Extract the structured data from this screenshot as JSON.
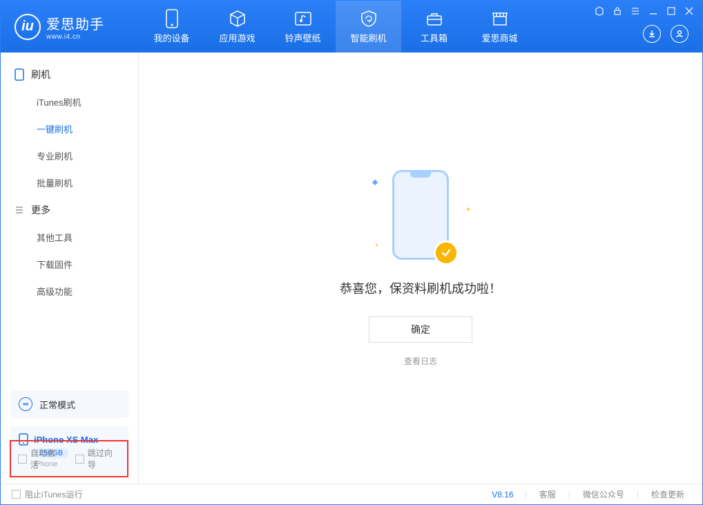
{
  "logo": {
    "main": "爱思助手",
    "sub": "www.i4.cn",
    "mark": "iu"
  },
  "nav": [
    {
      "label": "我的设备"
    },
    {
      "label": "应用游戏"
    },
    {
      "label": "铃声壁纸"
    },
    {
      "label": "智能刷机"
    },
    {
      "label": "工具箱"
    },
    {
      "label": "爱思商城"
    }
  ],
  "sidebar": {
    "section1": "刷机",
    "items1": [
      "iTunes刷机",
      "一键刷机",
      "专业刷机",
      "批量刷机"
    ],
    "section2": "更多",
    "items2": [
      "其他工具",
      "下载固件",
      "高级功能"
    ],
    "mode_card": "正常模式",
    "device": {
      "name": "iPhone XS Max",
      "storage": "256GB",
      "type": "iPhone"
    }
  },
  "checkboxes": {
    "auto_activate": "自动激活",
    "skip_guide": "跳过向导"
  },
  "main": {
    "success_text": "恭喜您，保资料刷机成功啦！",
    "confirm": "确定",
    "view_log": "查看日志"
  },
  "footer": {
    "block_itunes": "阻止iTunes运行",
    "version": "V8.16",
    "links": [
      "客服",
      "微信公众号",
      "检查更新"
    ]
  }
}
